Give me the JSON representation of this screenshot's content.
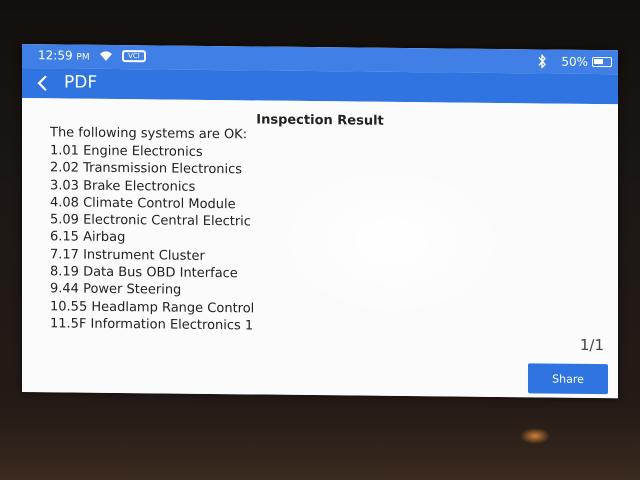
{
  "status_bar": {
    "time": "12:59",
    "ampm": "PM",
    "battery": "50%",
    "vci_label": "VCI"
  },
  "title_bar": {
    "title": "PDF"
  },
  "report": {
    "heading": "Inspection Result",
    "intro": "The following systems are OK:",
    "items": [
      "1.01 Engine Electronics",
      "2.02 Transmission Electronics",
      "3.03 Brake Electronics",
      "4.08 Climate Control Module",
      "5.09 Electronic Central Electric",
      "6.15 Airbag",
      "7.17 Instrument Cluster",
      "8.19 Data Bus OBD Interface",
      "9.44 Power Steering",
      "10.55 Headlamp Range Control",
      "11.5F Information Electronics 1"
    ],
    "page": "1/1"
  },
  "actions": {
    "share_label": "Share"
  },
  "colors": {
    "status_bar": "#3f7fe6",
    "title_bar": "#2f74e0",
    "share_button": "#2f74e0"
  }
}
